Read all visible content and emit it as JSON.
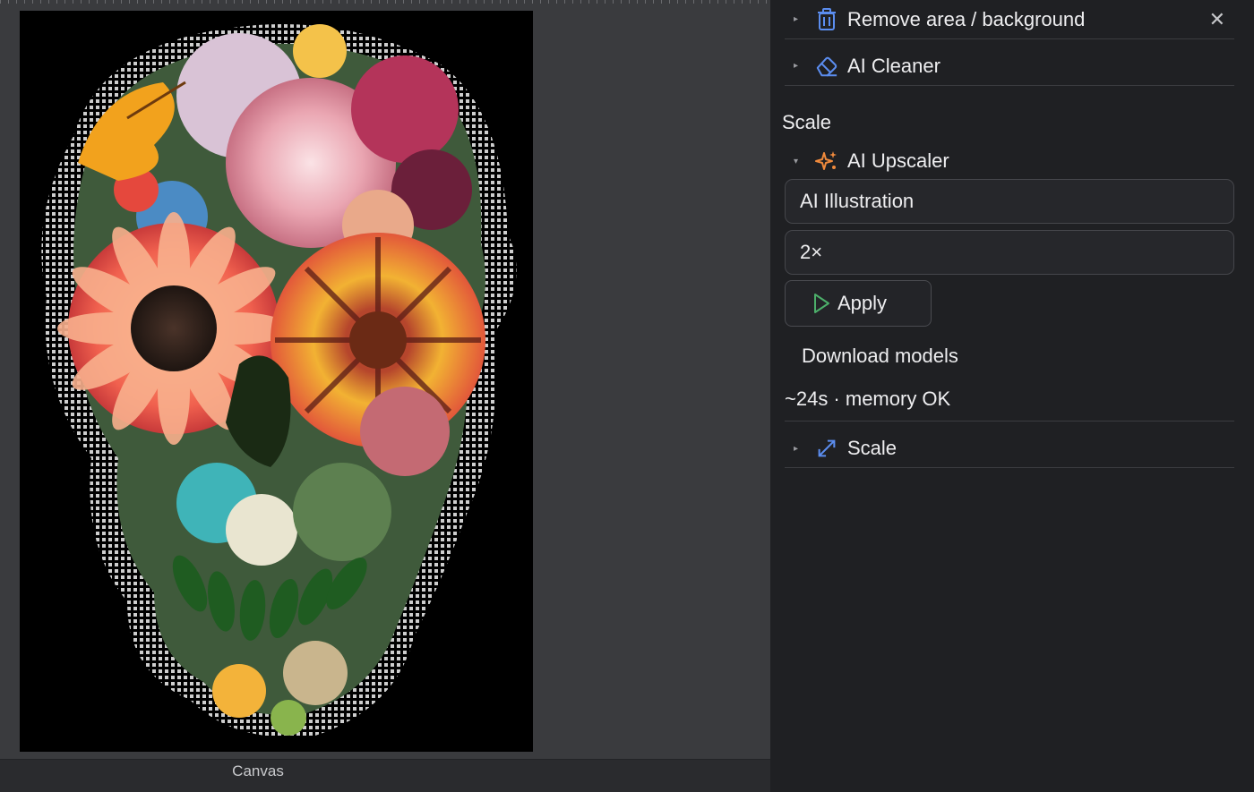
{
  "canvas": {
    "label": "Canvas"
  },
  "panel": {
    "remove_section": {
      "title": "Remove area / background",
      "icon": "trash-icon",
      "close": "✕"
    },
    "cleaner_section": {
      "title": "AI Cleaner",
      "icon": "eraser-icon"
    },
    "scale_heading": "Scale",
    "upscaler_section": {
      "title": "AI Upscaler",
      "icon": "sparkle-icon"
    },
    "model_select": {
      "value": "AI Illustration"
    },
    "factor_select": {
      "value": "2×"
    },
    "apply_label": "Apply",
    "download_label": "Download models",
    "status": "~24s · memory OK",
    "scale_section": {
      "title": "Scale",
      "icon": "resize-arrows-icon"
    }
  },
  "colors": {
    "accent_blue": "#5b8def",
    "accent_orange": "#f08a3c",
    "apply_green": "#4caf6a"
  }
}
